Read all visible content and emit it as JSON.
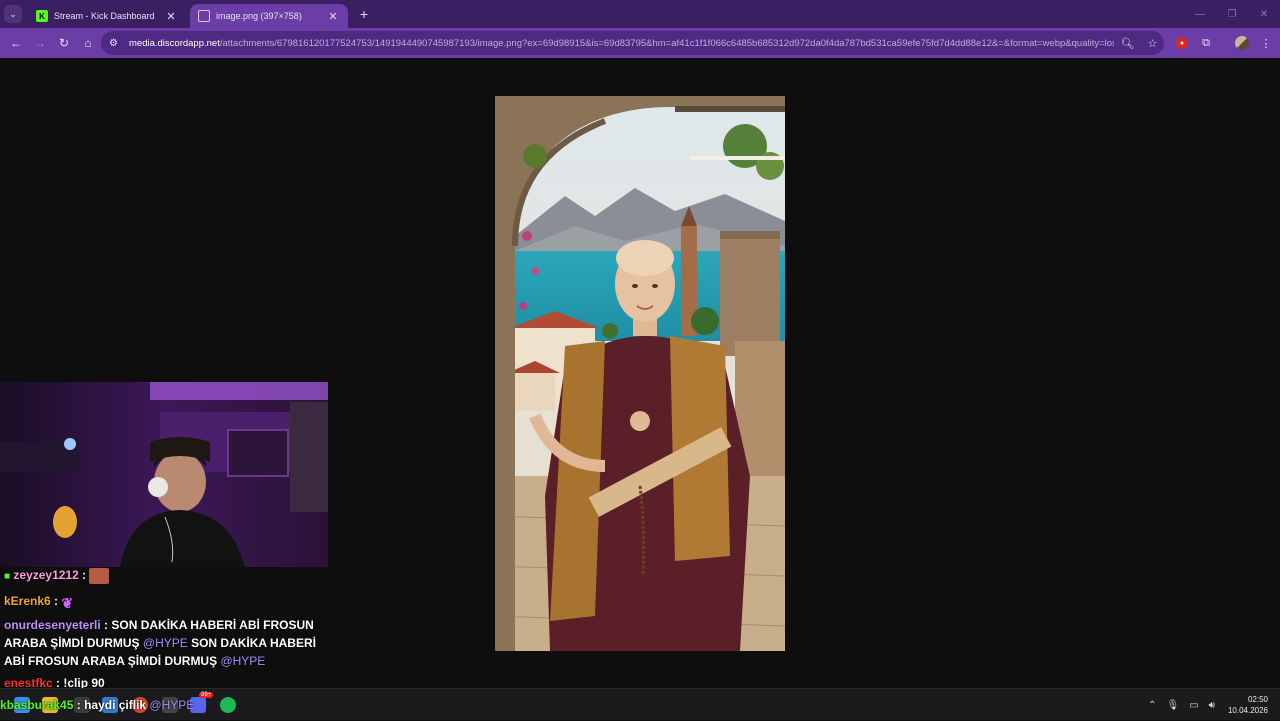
{
  "browser": {
    "tabs": [
      {
        "title": "Stream - Kick Dashboard",
        "favicon": "kick-icon",
        "active": false
      },
      {
        "title": "image.png (397×758)",
        "favicon": "globe-icon",
        "active": true
      }
    ],
    "new_tab": "+",
    "url_host": "media.discordapp.net",
    "url_path": "/attachments/679816120177524753/1491944490745987193/image.png?ex=69d98915&is=69d83795&hm=af41c1f1f066c6485b685312d972da0f4da787bd531ca59efe75fd7d4dd88e12&=&format=webp&quality=los...",
    "accent": "#6a3ea6"
  },
  "chat": {
    "messages": [
      {
        "user": "zeyzey1212",
        "user_color": "#ff9bd8",
        "sep": " : ",
        "text": "",
        "emote": "car-emote",
        "badge": "camera-badge"
      },
      {
        "user": "kErenk6",
        "user_color": "#f5a623",
        "sep": " : ",
        "text": "",
        "emote": "butterfly-emote"
      },
      {
        "user": "onurdesenyeterli",
        "user_color": "#c58cff",
        "sep": " : ",
        "text_a": "SON DAKİKA HABERİ ABİ FROSUN ARABA ŞİMDİ DURMUŞ ",
        "mention_a": "@HYPE",
        "text_b": " SON DAKİKA HABERİ ABİ FROSUN ARABA ŞİMDİ DURMUŞ ",
        "mention_b": "@HYPE"
      },
      {
        "user": "enestfkc",
        "user_color": "#ff2d2d",
        "sep": " : ",
        "text": "!clip 90"
      }
    ],
    "overlay_user": "kbasburak45",
    "overlay_sep": " : ",
    "overlay_text": "haydi çiflik ",
    "overlay_mention": "@HYPE"
  },
  "taskbar": {
    "time": "02:50",
    "date": "10.04.2026",
    "discord_badge": "99+"
  }
}
